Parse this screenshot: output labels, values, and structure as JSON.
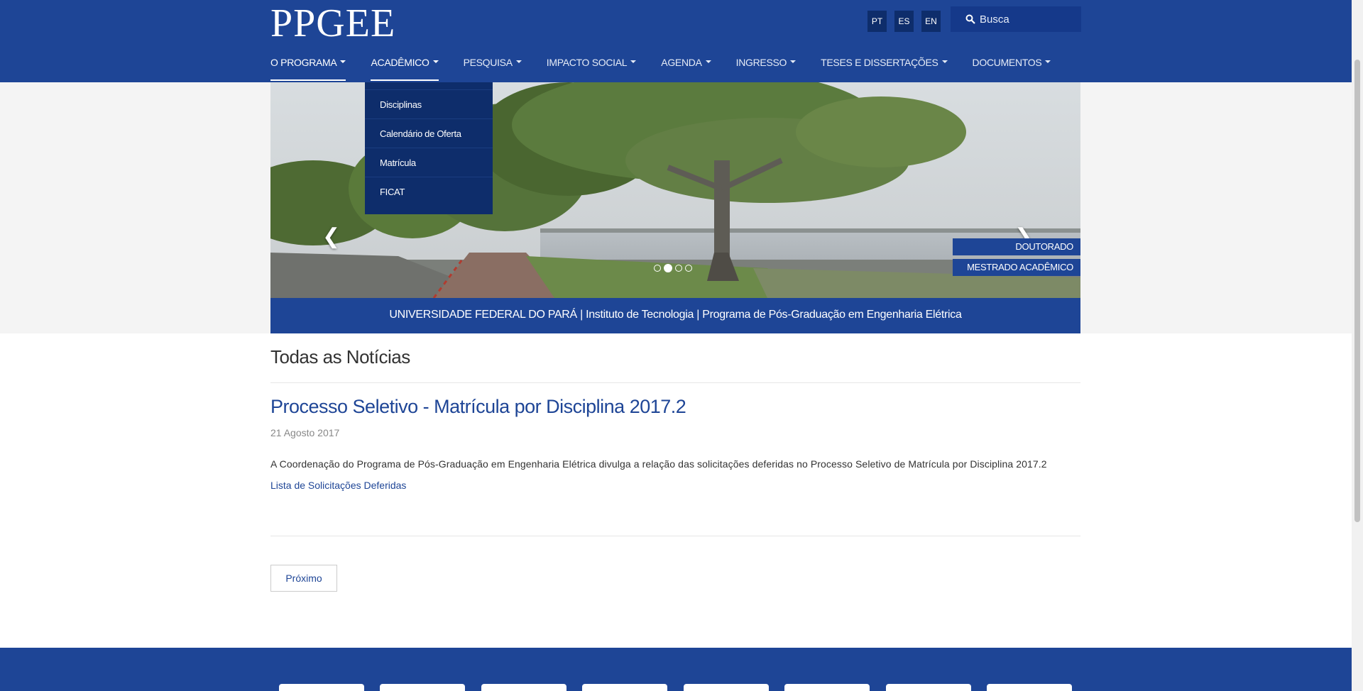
{
  "header": {
    "logo": "PPGEE",
    "languages": [
      "PT",
      "ES",
      "EN"
    ],
    "search_placeholder": "Busca"
  },
  "nav": {
    "items": [
      {
        "label": "O PROGRAMA"
      },
      {
        "label": "ACADÊMICO"
      },
      {
        "label": "PESQUISA"
      },
      {
        "label": "IMPACTO SOCIAL"
      },
      {
        "label": "AGENDA"
      },
      {
        "label": "INGRESSO"
      },
      {
        "label": "TESES E DISSERTAÇÕES"
      },
      {
        "label": "DOCUMENTOS"
      }
    ],
    "dropdown": [
      "Disciplinas",
      "Calendário de Oferta",
      "Matrícula",
      "FICAT"
    ]
  },
  "carousel": {
    "tags": [
      "DOUTORADO",
      "MESTRADO ACADÊMICO"
    ],
    "slide_count": 4,
    "active_slide": 2
  },
  "banner": "UNIVERSIDADE FEDERAL DO PARÁ | Instituto de Tecnologia | Programa de Pós-Graduação em Engenharia Elétrica",
  "main": {
    "section_title": "Todas as Notícias",
    "article": {
      "title": "Processo Seletivo - Matrícula por Disciplina 2017.2",
      "date": "21 Agosto 2017",
      "body": "A Coordenação do Programa de Pós-Graduação em Engenharia Elétrica divulga a relação das solicitações deferidas no Processo Seletivo de Matrícula por Disciplina 2017.2",
      "link": "Lista de Solicitações Deferidas"
    },
    "next_button": "Próximo"
  },
  "colors": {
    "primary": "#1e4596",
    "dark": "#0e2d6b",
    "link": "#1e4596"
  }
}
